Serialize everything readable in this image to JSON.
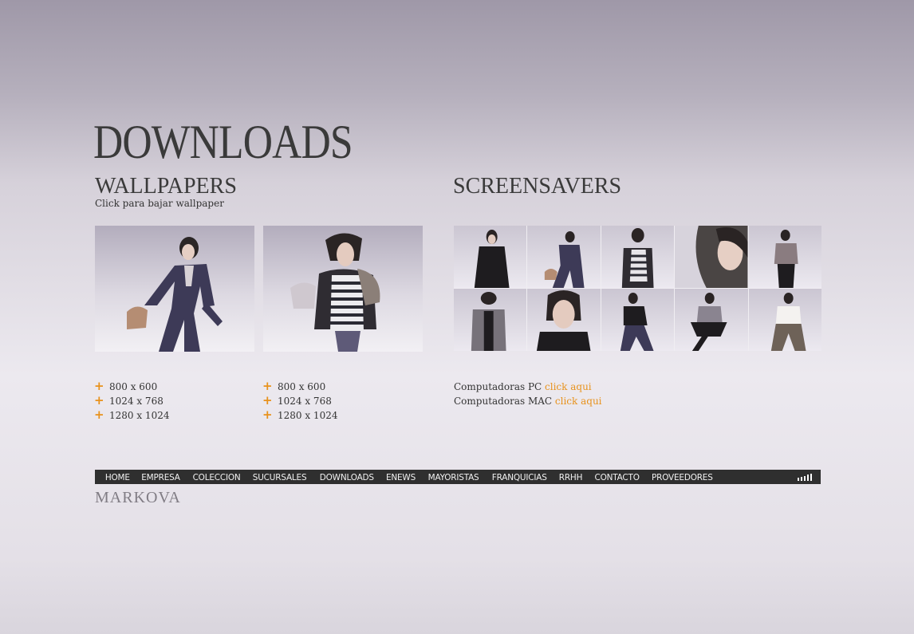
{
  "page_title": "DOWNLOADS",
  "wallpapers": {
    "title": "WALLPAPERS",
    "subtitle": "Click para bajar wallpaper",
    "columns": [
      {
        "resolutions": [
          "800 x 600",
          "1024 x 768",
          "1280 x 1024"
        ]
      },
      {
        "resolutions": [
          "800 x 600",
          "1024 x 768",
          "1280 x 1024"
        ]
      }
    ]
  },
  "screensavers": {
    "title": "SCREENSAVERS",
    "pc_label": "Computadoras PC",
    "pc_link": "click aqui",
    "mac_label": "Computadoras MAC",
    "mac_link": "click aqui"
  },
  "nav": {
    "items": [
      "HOME",
      "EMPRESA",
      "COLECCION",
      "SUCURSALES",
      "DOWNLOADS",
      "ENEWS",
      "MAYORISTAS",
      "FRANQUICIAS",
      "RRHH",
      "CONTACTO",
      "PROVEEDORES"
    ]
  },
  "brand": "MARKOVA",
  "colors": {
    "accent": "#e8921c",
    "nav_bg": "#2f2f2f",
    "text": "#333333"
  }
}
